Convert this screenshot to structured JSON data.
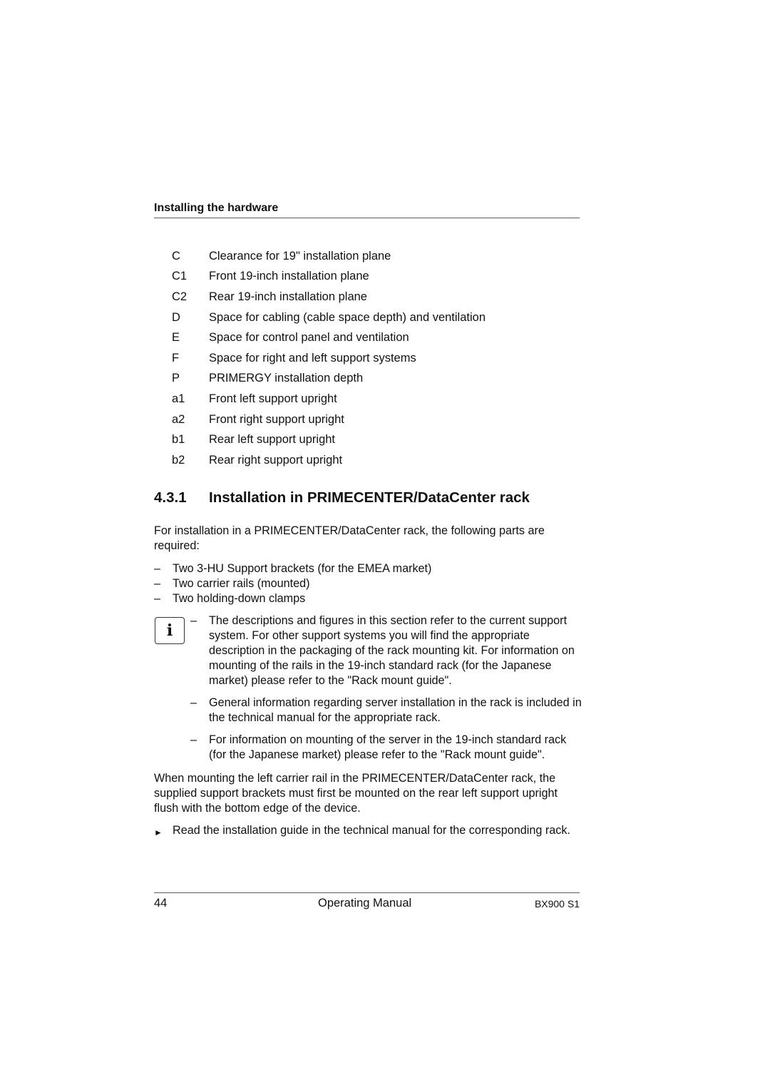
{
  "header": {
    "title": "Installing the hardware"
  },
  "legend": [
    {
      "key": "C",
      "text": "Clearance for 19\" installation plane"
    },
    {
      "key": "C1",
      "text": "Front 19-inch installation plane"
    },
    {
      "key": "C2",
      "text": "Rear 19-inch installation plane"
    },
    {
      "key": "D",
      "text": "Space for cabling (cable space depth) and ventilation"
    },
    {
      "key": "E",
      "text": "Space for control panel and ventilation"
    },
    {
      "key": "F",
      "text": "Space for right and left support systems"
    },
    {
      "key": "P",
      "text": "PRIMERGY installation depth"
    },
    {
      "key": "a1",
      "text": "Front left support upright"
    },
    {
      "key": "a2",
      "text": "Front right support upright"
    },
    {
      "key": "b1",
      "text": "Rear left support upright"
    },
    {
      "key": "b2",
      "text": "Rear right support upright"
    }
  ],
  "section": {
    "number": "4.3.1",
    "title": "Installation in PRIMECENTER/DataCenter rack"
  },
  "intro": "For installation in a PRIMECENTER/DataCenter rack, the following parts are required:",
  "parts": [
    "Two 3-HU Support brackets (for the EMEA market)",
    "Two carrier rails (mounted)",
    "Two holding-down clamps"
  ],
  "info_icon": {
    "glyph": "i",
    "name": "info-icon"
  },
  "notes": [
    "The descriptions and figures in this section refer to the current support system. For other support systems you will find the appropriate description in the packaging of the rack mounting kit. For information on mounting of the rails in the 19-inch standard rack (for the Japanese market) please refer to the \"Rack mount guide\".",
    "General information regarding server installation in the rack is included in the technical manual for the appropriate rack.",
    "For information on mounting of the server in the 19-inch standard rack (for the Japanese market) please refer to the \"Rack mount guide\"."
  ],
  "paragraph": "When mounting the left carrier rail in the PRIMECENTER/DataCenter rack, the supplied support brackets must first be mounted on the rear left support upright flush with the bottom edge of the device.",
  "step": {
    "arrow": "►",
    "text": "Read the installation guide in the technical manual for the corresponding rack."
  },
  "dash": "–",
  "footer": {
    "page": "44",
    "manual": "Operating Manual",
    "model": "BX900 S1"
  }
}
